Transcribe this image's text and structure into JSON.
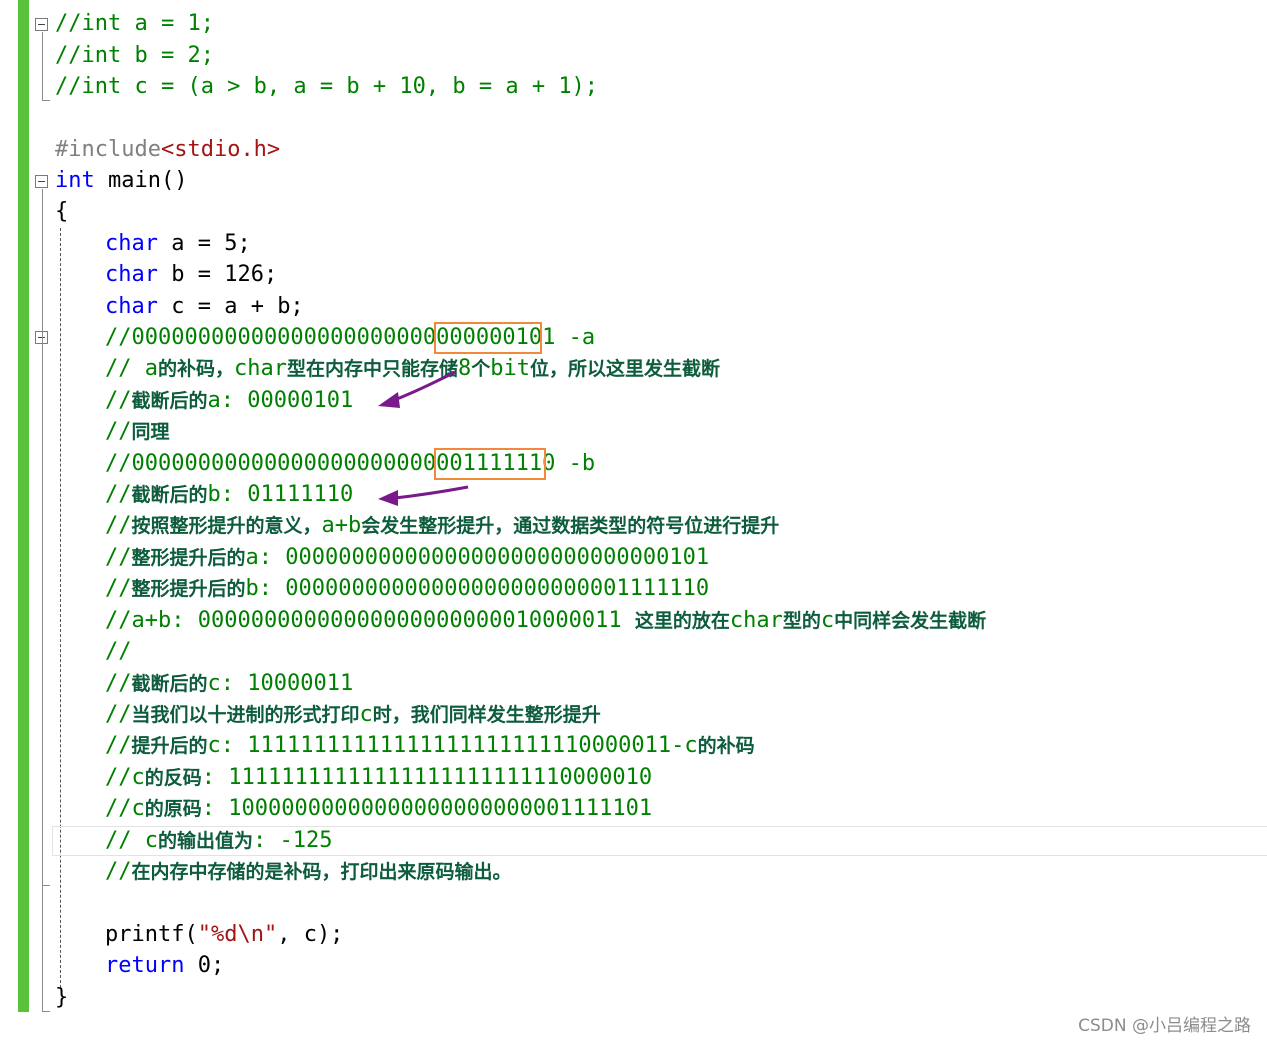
{
  "code": {
    "l1": "//int a = 1;",
    "l2": "//int b = 2;",
    "l3": "//int c = (a > b, a = b + 10, b = a + 1);",
    "l5a": "#include",
    "l5b": "<stdio.h>",
    "l6a": "int",
    "l6b": " main()",
    "l7": "{",
    "l8a": "char",
    "l8b": " a = 5;",
    "l9a": "char",
    "l9b": " b = 126;",
    "l10a": "char",
    "l10b": " c = a + b;",
    "l11": "//00000000000000000000000000000101 -a",
    "l12a": "// a",
    "l12b": "的补码，",
    "l12c": "char",
    "l12d": "型在内存中只能存储",
    "l12e": "8",
    "l12f": "个",
    "l12g": "bit",
    "l12h": "位，所以这里发生截断",
    "l13a": "//",
    "l13b": "截断后的",
    "l13c": "a: 00000101",
    "l14a": "//",
    "l14b": "同理",
    "l15": "//00000000000000000000000001111110 -b",
    "l16a": "//",
    "l16b": "截断后的",
    "l16c": "b: 01111110",
    "l17a": "//",
    "l17b": "按照整形提升的意义，",
    "l17c": "a+b",
    "l17d": "会发生整形提升，通过数据类型的符号位进行提升",
    "l18a": "//",
    "l18b": "整形提升后的",
    "l18c": "a: 00000000000000000000000000000101",
    "l19a": "//",
    "l19b": "整形提升后的",
    "l19c": "b: 00000000000000000000000001111110",
    "l20a": "//a+b: 00000000000000000000000010000011 ",
    "l20b": "这里的放在",
    "l20c": "char",
    "l20d": "型的",
    "l20e": "c",
    "l20f": "中同样会发生截断",
    "l21": "//",
    "l22a": "//",
    "l22b": "截断后的",
    "l22c": "c: 10000011",
    "l23a": "//",
    "l23b": "当我们以十进制的形式打印",
    "l23c": "c",
    "l23d": "时，我们同样发生整形提升",
    "l24a": "//",
    "l24b": "提升后的",
    "l24c": "c: 11111111111111111111111110000011-c",
    "l24d": "的补码",
    "l25a": "//c",
    "l25b": "的反码",
    "l25c": ": 11111111111111111111111110000010",
    "l26a": "//c",
    "l26b": "的原码",
    "l26c": ": 10000000000000000000000001111101",
    "l27a": "// c",
    "l27b": "的输出值为",
    "l27c": ": -125",
    "l28a": "//",
    "l28b": "在内存中存储的是补码，打印出来原码输出。",
    "l30a": "printf(",
    "l30b": "\"%d\\n\"",
    "l30c": ", c);",
    "l31a": "return",
    "l31b": " 0;",
    "l32": "}"
  },
  "watermark": "CSDN @小吕编程之路",
  "colors": {
    "gutter": "#57c23a",
    "highlight_box": "#ef8a3a",
    "arrow": "#7a1a8a"
  }
}
